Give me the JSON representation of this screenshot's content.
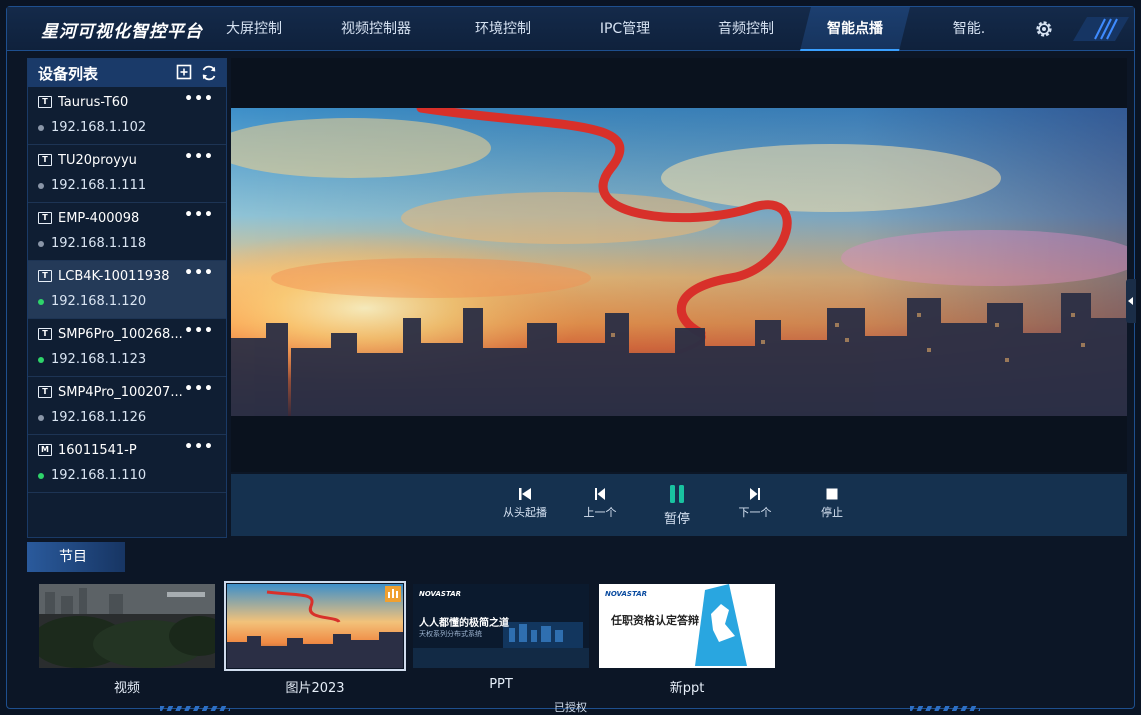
{
  "app": {
    "title": "星河可视化智控平台",
    "footer_status": "已授权"
  },
  "nav": {
    "tabs": [
      {
        "label": "大屏控制",
        "active": false
      },
      {
        "label": "视频控制器",
        "active": false
      },
      {
        "label": "环境控制",
        "active": false
      },
      {
        "label": "IPC管理",
        "active": false
      },
      {
        "label": "音频控制",
        "active": false
      },
      {
        "label": "智能点播",
        "active": true
      },
      {
        "label": "智能.",
        "active": false
      }
    ],
    "settings_icon": "gear-icon"
  },
  "device_panel": {
    "title": "设备列表",
    "icons": [
      "add-box-icon",
      "refresh-icon"
    ],
    "devices": [
      {
        "badge": "T",
        "name": "Taurus-T60",
        "ip": "192.168.1.102",
        "status": "offline",
        "more": "•••"
      },
      {
        "badge": "T",
        "name": "TU20proyyu",
        "ip": "192.168.1.111",
        "status": "offline",
        "more": "•••"
      },
      {
        "badge": "T",
        "name": "EMP-400098",
        "ip": "192.168.1.118",
        "status": "offline",
        "more": "•••"
      },
      {
        "badge": "T",
        "name": "LCB4K-10011938",
        "ip": "192.168.1.120",
        "status": "online",
        "more": "•••",
        "selected": true
      },
      {
        "badge": "T",
        "name": "SMP6Pro_100268...",
        "ip": "192.168.1.123",
        "status": "online",
        "more": "•••"
      },
      {
        "badge": "T",
        "name": "SMP4Pro_100207...",
        "ip": "192.168.1.126",
        "status": "offline",
        "more": "•••"
      },
      {
        "badge": "M",
        "name": "16011541-P",
        "ip": "192.168.1.110",
        "status": "online",
        "more": "•••"
      }
    ]
  },
  "playback": {
    "controls": [
      {
        "icon": "skip-to-start-icon",
        "label": "从头起播"
      },
      {
        "icon": "previous-icon",
        "label": "上一个"
      },
      {
        "icon": "pause-icon",
        "label": "暂停"
      },
      {
        "icon": "next-icon",
        "label": "下一个"
      },
      {
        "icon": "stop-icon",
        "label": "停止"
      }
    ]
  },
  "programs": {
    "tab_label": "节目",
    "items": [
      {
        "label": "视频",
        "selected": false
      },
      {
        "label": "图片2023",
        "selected": true
      },
      {
        "label": "PPT",
        "selected": false
      },
      {
        "label": "新ppt",
        "selected": false
      }
    ],
    "ppt_thumb_text": [
      "NOVASTAR",
      "人人都懂的极简之道",
      "天权系列分布式系统"
    ],
    "newppt_thumb_text": [
      "NOVASTAR",
      "任职资格认定答辩"
    ]
  },
  "colors": {
    "accent": "#3aa0ff",
    "panel_header": "#1a3a69",
    "online": "#2ed46a",
    "offline": "#8a96a8",
    "pause_green": "#19c2a0"
  }
}
